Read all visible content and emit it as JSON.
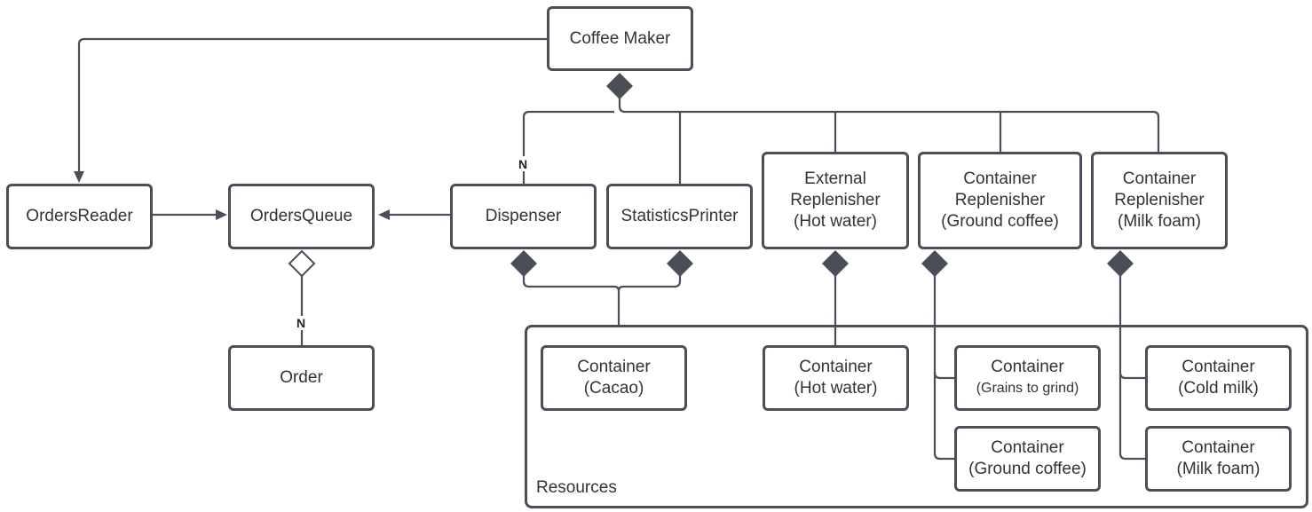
{
  "diagram": {
    "colors": {
      "line": "#4a4f57",
      "text": "#333333",
      "background": "#ffffff"
    },
    "nodes": {
      "coffee_maker": {
        "label": "Coffee Maker"
      },
      "orders_reader": {
        "label": "OrdersReader"
      },
      "orders_queue": {
        "label": "OrdersQueue"
      },
      "order": {
        "label": "Order"
      },
      "dispenser": {
        "label": "Dispenser"
      },
      "statistics_printer": {
        "label": "StatisticsPrinter"
      },
      "external_replenisher": {
        "line1": "External",
        "line2": "Replenisher",
        "line3": "(Hot water)"
      },
      "container_replenisher_ground": {
        "line1": "Container",
        "line2": "Replenisher",
        "line3": "(Ground coffee)"
      },
      "container_replenisher_milk": {
        "line1": "Container",
        "line2": "Replenisher",
        "line3": "(Milk foam)"
      },
      "container_cacao": {
        "line1": "Container",
        "line2": "(Cacao)"
      },
      "container_hot_water": {
        "line1": "Container",
        "line2": "(Hot water)"
      },
      "container_grains": {
        "line1": "Container",
        "line2": "(Grains to grind)"
      },
      "container_ground_coffee": {
        "line1": "Container",
        "line2": "(Ground coffee)"
      },
      "container_cold_milk": {
        "line1": "Container",
        "line2": "(Cold milk)"
      },
      "container_milk_foam": {
        "line1": "Container",
        "line2": "(Milk foam)"
      }
    },
    "group": {
      "label": "Resources"
    },
    "multiplicities": {
      "dispenser": "N",
      "order": "N"
    },
    "relations": [
      {
        "from": "coffee_maker",
        "to": "orders_reader",
        "type": "association-arrow"
      },
      {
        "from": "orders_reader",
        "to": "orders_queue",
        "type": "association-arrow"
      },
      {
        "from": "dispenser",
        "to": "orders_queue",
        "type": "association-arrow"
      },
      {
        "from": "orders_queue",
        "to": "order",
        "type": "aggregation",
        "multiplicity": "N"
      },
      {
        "from": "coffee_maker",
        "to": "dispenser",
        "type": "composition",
        "multiplicity": "N"
      },
      {
        "from": "coffee_maker",
        "to": "statistics_printer",
        "type": "composition"
      },
      {
        "from": "coffee_maker",
        "to": "external_replenisher",
        "type": "composition"
      },
      {
        "from": "coffee_maker",
        "to": "container_replenisher_ground",
        "type": "composition"
      },
      {
        "from": "coffee_maker",
        "to": "container_replenisher_milk",
        "type": "composition"
      },
      {
        "from": "dispenser",
        "to": "resources",
        "type": "composition"
      },
      {
        "from": "statistics_printer",
        "to": "resources",
        "type": "composition"
      },
      {
        "from": "external_replenisher",
        "to": "container_hot_water",
        "type": "composition"
      },
      {
        "from": "container_replenisher_ground",
        "to": "container_grains",
        "type": "composition"
      },
      {
        "from": "container_replenisher_ground",
        "to": "container_ground_coffee",
        "type": "composition"
      },
      {
        "from": "container_replenisher_milk",
        "to": "container_cold_milk",
        "type": "composition"
      },
      {
        "from": "container_replenisher_milk",
        "to": "container_milk_foam",
        "type": "composition"
      }
    ]
  }
}
